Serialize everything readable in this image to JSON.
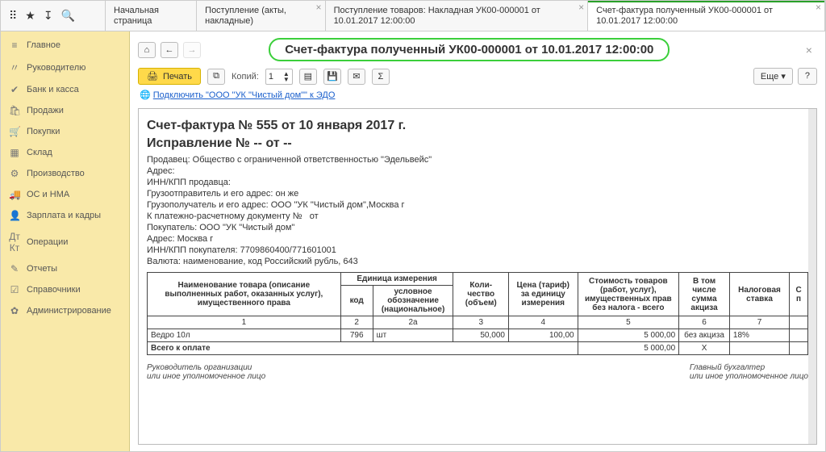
{
  "topIcons": [
    "⠿",
    "★",
    "↧",
    "🔍"
  ],
  "tabs": [
    {
      "label": "Начальная страница",
      "closable": false
    },
    {
      "label": "Поступление (акты, накладные)",
      "closable": true
    },
    {
      "label": "Поступление товаров: Накладная УК00-000001 от 10.01.2017 12:00:00",
      "closable": true
    },
    {
      "label": "Счет-фактура полученный УК00-000001 от 10.01.2017 12:00:00",
      "closable": true,
      "active": true
    }
  ],
  "sidebar": [
    {
      "icon": "≡",
      "label": "Главное"
    },
    {
      "icon": "〃",
      "label": "Руководителю"
    },
    {
      "icon": "✔",
      "label": "Банк и касса"
    },
    {
      "icon": "🛍",
      "label": "Продажи"
    },
    {
      "icon": "🛒",
      "label": "Покупки"
    },
    {
      "icon": "▦",
      "label": "Склад"
    },
    {
      "icon": "⚙",
      "label": "Производство"
    },
    {
      "icon": "🚚",
      "label": "ОС и НМА"
    },
    {
      "icon": "👤",
      "label": "Зарплата и кадры"
    },
    {
      "icon": "Дт Кт",
      "label": "Операции"
    },
    {
      "icon": "✎",
      "label": "Отчеты"
    },
    {
      "icon": "☑",
      "label": "Справочники"
    },
    {
      "icon": "✿",
      "label": "Администрирование"
    }
  ],
  "contentTitle": "Счет-фактура полученный УК00-000001 от 10.01.2017 12:00:00",
  "toolbar": {
    "print": "Печать",
    "copies_label": "Копий:",
    "copies_value": "1",
    "more": "Еще",
    "help": "?"
  },
  "edo_prefix": "🌐 ",
  "edo_link": "Подключить \"ООО \"УК \"Чистый дом\"\" к ЭДО",
  "doc": {
    "h1": "Счет-фактура № 555 от 10 января 2017 г.",
    "h2": "Исправление № -- от --",
    "lines": [
      "Продавец: Общество с ограниченной ответственностью \"Эдельвейс\"",
      "Адрес:",
      "ИНН/КПП продавца:",
      "Грузоотправитель и его адрес: он же",
      "Грузополучатель и его адрес: ООО \"УК \"Чистый дом\",Москва г",
      "К платежно-расчетному документу №   от",
      "Покупатель: ООО \"УК \"Чистый дом\"",
      "Адрес: Москва г",
      "ИНН/КПП покупателя: 7709860400/771601001",
      "Валюта: наименование, код Российский рубль, 643"
    ],
    "headers": {
      "name": "Наименование товара (описание выполненных работ, оказанных услуг), имущественного права",
      "unit": "Единица измерения",
      "code": "код",
      "unit_name": "условное обозначение (национальное)",
      "qty": "Коли-чество (объем)",
      "price": "Цена (тариф) за единицу измерения",
      "cost": "Стоимость товаров (работ, услуг), имущественных прав без налога - всего",
      "excise": "В том числе сумма акциза",
      "rate": "Налоговая ставка",
      "extra": "С\nп"
    },
    "nums": [
      "1",
      "2",
      "2а",
      "3",
      "4",
      "5",
      "6",
      "7"
    ],
    "row": {
      "name": "Ведро 10л",
      "code": "796",
      "unit": "шт",
      "qty": "50,000",
      "price": "100,00",
      "cost": "5 000,00",
      "excise": "без акциза",
      "rate": "18%"
    },
    "total_label": "Всего к оплате",
    "total_cost": "5 000,00",
    "total_excise": "Х",
    "sig_left": "Руководитель организации\nили иное уполномоченное лицо",
    "sig_right": "Главный бухгалтер\nили иное уполномоченное лицо"
  }
}
